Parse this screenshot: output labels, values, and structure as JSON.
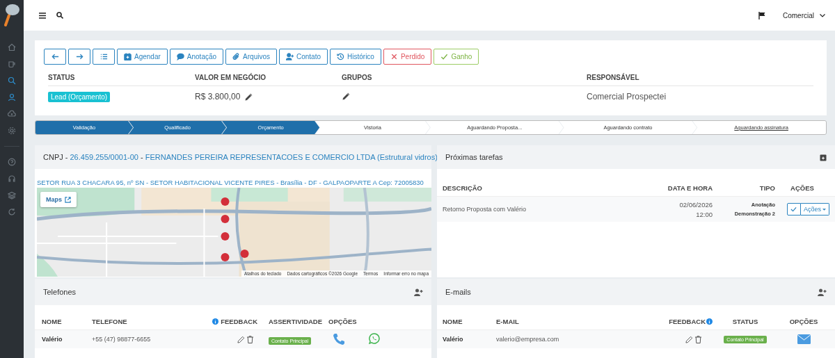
{
  "topbar": {
    "user": "Comercial"
  },
  "sidebar": {
    "items": [
      {
        "selected": false
      },
      {
        "selected": false
      },
      {
        "selected": true
      },
      {
        "selected": true
      },
      {
        "selected": false
      },
      {
        "selected": false
      },
      {
        "selected": false
      },
      {
        "selected": false
      },
      {
        "selected": false
      },
      {
        "selected": false
      }
    ]
  },
  "toolbar": {
    "buttons": [
      {
        "kind": "default"
      },
      {
        "kind": "default"
      },
      {
        "kind": "default"
      },
      {
        "kind": "default",
        "label": "Agendar"
      },
      {
        "kind": "default",
        "label": "Anotação"
      },
      {
        "kind": "default",
        "label": "Arquivos"
      },
      {
        "kind": "default",
        "label": "Contato"
      },
      {
        "kind": "default",
        "label": "Histórico"
      },
      {
        "kind": "danger",
        "label": "Perdido"
      },
      {
        "kind": "success",
        "label": "Ganho"
      }
    ]
  },
  "summary": {
    "columns": [
      "STATUS",
      "VALOR EM NEGÓCIO",
      "GRUPOS",
      "RESPONSÁVEL"
    ],
    "status": "Lead (Orçamento)",
    "value": "R$ 3.800,00",
    "responsible": "Comercial Prospectei"
  },
  "pipeline": [
    {
      "label": "Validação",
      "done": true,
      "kind": "stage"
    },
    {
      "label": "Qualificado",
      "done": true,
      "kind": "stage"
    },
    {
      "label": "Orçamento",
      "done": true,
      "kind": "stage"
    },
    {
      "label": "Vistoria",
      "done": false,
      "kind": "stage"
    },
    {
      "label": "Aguardando Proposta...",
      "done": false,
      "kind": "stage"
    },
    {
      "label": "Aguardando contrato",
      "done": false,
      "kind": "stage"
    },
    {
      "label": "Aguardando assinatura",
      "done": false,
      "kind": "link"
    }
  ],
  "company": {
    "label": "CNPJ",
    "separator": "-",
    "cnpj": "26.459.255/0001-00",
    "name": "FERNANDES PEREIRA REPRESENTACOES E COMERCIO LTDA (Estrutural vidros)",
    "address": "SETOR RUA 3 CHACARA 95, nº SN - SETOR HABITACIONAL VICENTE PIRES - Brasília - DF - GALPAOPARTE A Cep: 72005830",
    "map": {
      "kind": "picture",
      "button": "Maps",
      "attribution": [
        "Atalhos do teclado",
        "Dados cartográficos ©2026 Google",
        "Termos",
        "Informar erro no mapa"
      ]
    }
  },
  "tasks": {
    "title": "Próximas tarefas",
    "columns": [
      "DESCRIÇÃO",
      "DATA E HORA",
      "TIPO",
      "AÇÕES"
    ],
    "rows": [
      {
        "description": "Retorno Proposta com Valério",
        "date": "02/06/2026",
        "time": "12:00",
        "types": [
          "Anotação",
          "Demonstração 2"
        ],
        "action": "Ações"
      }
    ]
  },
  "phones": {
    "title": "Telefones",
    "columns": [
      "NOME",
      "TELEFONE",
      "FEEDBACK",
      "ASSERTIVIDADE",
      "OPÇÕES"
    ],
    "rows": [
      {
        "name": "Valério",
        "phone": "+55 (47) 98877-6655",
        "badge": "Contato Principal"
      }
    ]
  },
  "emails": {
    "title": "E-mails",
    "columns": [
      "NOME",
      "E-MAIL",
      "FEEDBACK",
      "STATUS",
      "OPÇÕES"
    ],
    "rows": [
      {
        "name": "Valério",
        "email": "valerio@empresa.com",
        "badge": "Contato Principal"
      }
    ]
  }
}
